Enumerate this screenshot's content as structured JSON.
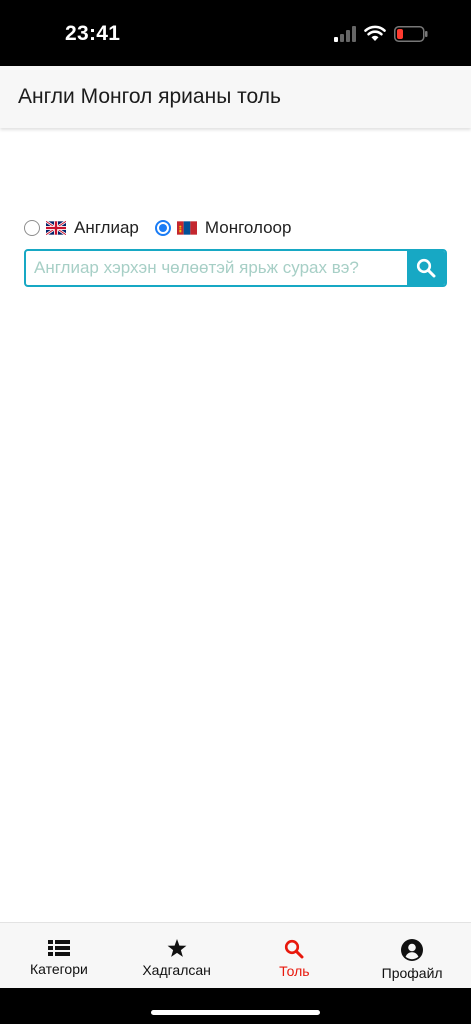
{
  "status_bar": {
    "time": "23:41",
    "battery_color": "#ff3b30"
  },
  "header": {
    "title": "Англи Монгол ярианы толь"
  },
  "language_options": [
    {
      "label": "Англиар",
      "flag": "uk-flag-icon",
      "selected": false
    },
    {
      "label": "Монголоор",
      "flag": "mongolia-flag-icon",
      "selected": true
    }
  ],
  "search": {
    "placeholder": "Англиар хэрхэн чөлөөтэй ярьж сурах вэ?",
    "value": "",
    "accent_color": "#17a8c4"
  },
  "tabs": [
    {
      "label": "Категори",
      "icon": "list-icon",
      "active": false
    },
    {
      "label": "Хадгалсан",
      "icon": "star-icon",
      "active": false
    },
    {
      "label": "Толь",
      "icon": "search-icon",
      "active": true
    },
    {
      "label": "Профайл",
      "icon": "user-circle-icon",
      "active": false
    }
  ],
  "active_tab_color": "#e8180c"
}
